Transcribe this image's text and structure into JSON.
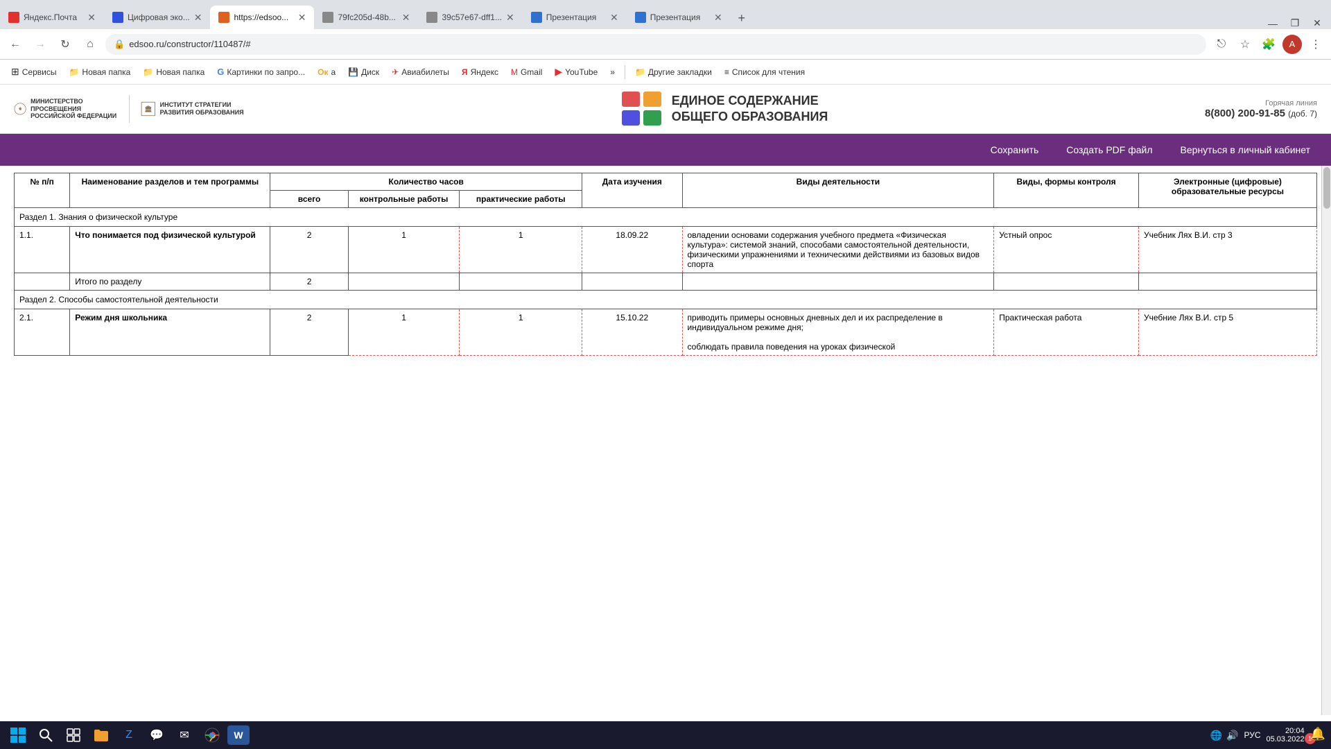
{
  "browser": {
    "tabs": [
      {
        "id": "tab1",
        "title": "Яндекс.Почта",
        "active": false,
        "favicon_color": "#e03030"
      },
      {
        "id": "tab2",
        "title": "Цифровая эко...",
        "active": false,
        "favicon_color": "#3050e0"
      },
      {
        "id": "tab3",
        "title": "https://edsoo...",
        "active": true,
        "favicon_color": "#e06020"
      },
      {
        "id": "tab4",
        "title": "79fc205d-48b...",
        "active": false,
        "favicon_color": "#555"
      },
      {
        "id": "tab5",
        "title": "39c57e67-dff1...",
        "active": false,
        "favicon_color": "#555"
      },
      {
        "id": "tab6",
        "title": "Презентация",
        "active": false,
        "favicon_color": "#3070d0"
      },
      {
        "id": "tab7",
        "title": "Презентация",
        "active": false,
        "favicon_color": "#3070d0"
      }
    ],
    "address": "edsoo.ru/constructor/110487/#",
    "win_controls": [
      "—",
      "□",
      "✕"
    ]
  },
  "bookmarks": [
    {
      "label": "Сервисы",
      "icon": "grid"
    },
    {
      "label": "Новая папка",
      "icon": "folder"
    },
    {
      "label": "Новая папка",
      "icon": "folder"
    },
    {
      "label": "Картинки по запро...",
      "icon": "google"
    },
    {
      "label": "a",
      "icon": "odnoklassniki"
    },
    {
      "label": "Диск",
      "icon": "disk"
    },
    {
      "label": "Авиабилеты",
      "icon": "avia"
    },
    {
      "label": "Яндекс",
      "icon": "yandex"
    },
    {
      "label": "Gmail",
      "icon": "gmail"
    },
    {
      "label": "YouTube",
      "icon": "youtube"
    },
    {
      "label": "»",
      "icon": "more"
    },
    {
      "label": "Другие закладки",
      "icon": "folder"
    },
    {
      "label": "Список для чтения",
      "icon": "list"
    }
  ],
  "site": {
    "logo_ministry": "МИНИСТЕРСТВО ПРОСВЕЩЕНИЯ РОССИЙСКОЙ ФЕДЕРАЦИИ",
    "logo_institute": "ИНСТИТУТ СТРАТЕГИИ РАЗВИТИЯ ОБРАЗОВАНИЯ",
    "logo_title_line1": "ЕДИНОЕ СОДЕРЖАНИЕ",
    "logo_title_line2": "ОБЩЕГО ОБРАЗОВАНИЯ",
    "hotline_label": "Горячая линия",
    "hotline_number": "8(800) 200-91-85",
    "hotline_ext": "(доб. 7)"
  },
  "toolbar": {
    "save": "Сохранить",
    "pdf": "Создать PDF файл",
    "cabinet": "Вернуться в личный кабинет"
  },
  "table": {
    "headers": {
      "num": "№ п/п",
      "name": "Наименование разделов и тем программы",
      "hours_total_label": "Количество часов",
      "hours_total": "всего",
      "hours_control": "контрольные работы",
      "hours_practice": "практические работы",
      "date": "Дата изучения",
      "activities": "Виды деятельности",
      "control_types": "Виды, формы контроля",
      "resources": "Электронные (цифровые) образовательные ресурсы"
    },
    "sections": [
      {
        "type": "section-header",
        "title": "Раздел 1. Знания о физической культуре"
      },
      {
        "type": "row",
        "num": "1.1.",
        "name": "Что понимается под физической культурой",
        "hours_total": "2",
        "hours_control": "1",
        "hours_practice": "1",
        "date": "18.09.22",
        "activities": "овладении основами содержания учебного предмета «Физическая культура»: системой знаний, способами самостоятельной деятельности, физическими упражнениями и техническими действиями из базовых видов спорта",
        "control_types": "Устный опрос",
        "resources": "Учебник Лях В.И. стр 3"
      },
      {
        "type": "total-row",
        "label": "Итого по разделу",
        "hours_total": "2"
      },
      {
        "type": "section-header",
        "title": "Раздел 2. Способы самостоятельной деятельности"
      },
      {
        "type": "row",
        "num": "2.1.",
        "name": "Режим дня школьника",
        "hours_total": "2",
        "hours_control": "1",
        "hours_practice": "1",
        "date": "15.10.22",
        "activities": "приводить примеры основных дневных дел и их распределение в индивидуальном режиме дня;\n\nсоблюдать правила поведения на уроках физической",
        "control_types": "Практическая работа",
        "resources": "Учебние Лях В.И. стр 5"
      }
    ]
  },
  "taskbar": {
    "time": "20:04",
    "date": "05.03.2022",
    "lang": "РУС",
    "notification_count": "1"
  }
}
